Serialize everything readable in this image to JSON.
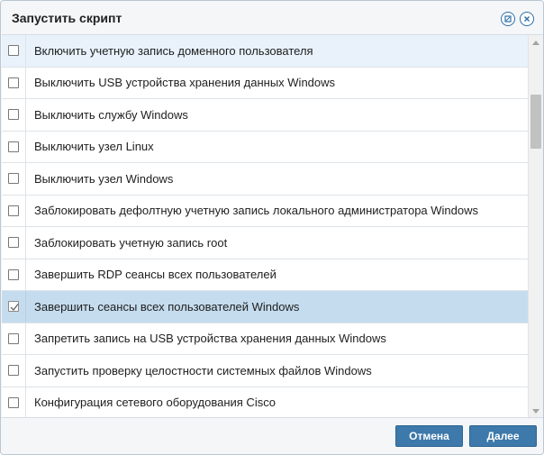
{
  "dialog": {
    "title": "Запустить скрипт",
    "icons": {
      "settings": "settings-circle-icon",
      "close": "close-circle-icon"
    }
  },
  "list": {
    "items": [
      {
        "label": "Включить учетную запись доменного пользователя",
        "checked": false,
        "state": "hover"
      },
      {
        "label": "Выключить USB устройства хранения данных Windows",
        "checked": false,
        "state": "normal"
      },
      {
        "label": "Выключить службу Windows",
        "checked": false,
        "state": "normal"
      },
      {
        "label": "Выключить узел Linux",
        "checked": false,
        "state": "normal"
      },
      {
        "label": "Выключить узел Windows",
        "checked": false,
        "state": "normal"
      },
      {
        "label": "Заблокировать дефолтную учетную запись локального администратора Windows",
        "checked": false,
        "state": "normal"
      },
      {
        "label": "Заблокировать учетную запись root",
        "checked": false,
        "state": "normal"
      },
      {
        "label": "Завершить RDP сеансы всех пользователей",
        "checked": false,
        "state": "normal"
      },
      {
        "label": "Завершить сеансы всех пользователей Windows",
        "checked": true,
        "state": "selected"
      },
      {
        "label": "Запретить запись на USB устройства хранения данных Windows",
        "checked": false,
        "state": "normal"
      },
      {
        "label": "Запустить проверку целостности системных файлов Windows",
        "checked": false,
        "state": "normal"
      },
      {
        "label": "Конфигурация сетевого оборудования Cisco",
        "checked": false,
        "state": "normal"
      }
    ]
  },
  "footer": {
    "cancel_label": "Отмена",
    "next_label": "Далее"
  },
  "colors": {
    "accent": "#3d79aa",
    "selected_row": "#c5dcee",
    "hover_row": "#e9f2fb"
  }
}
